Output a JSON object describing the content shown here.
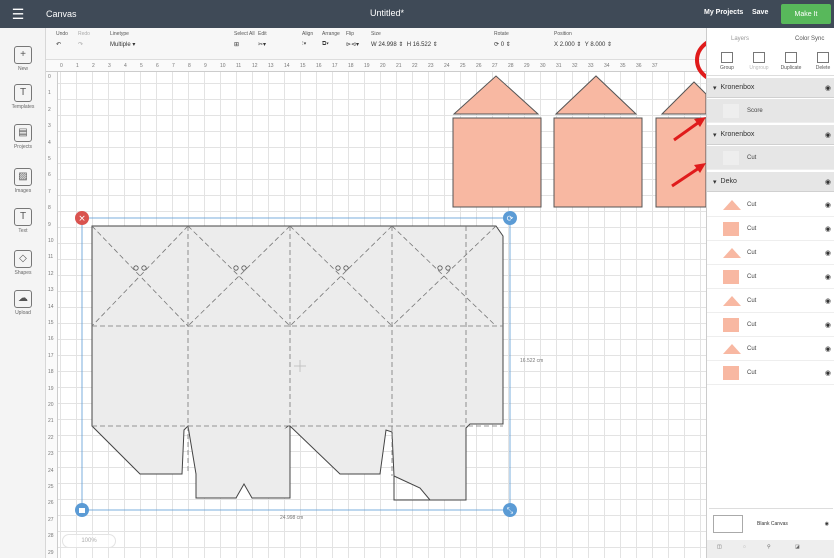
{
  "topbar": {
    "app_title": "Canvas",
    "doc_title": "Untitled*",
    "my_projects": "My Projects",
    "save": "Save",
    "make_it": "Make It"
  },
  "leftbar": [
    {
      "label": "New",
      "icon": "plus-icon",
      "glyph": "+"
    },
    {
      "label": "Templates",
      "icon": "shirt-icon",
      "glyph": "T"
    },
    {
      "label": "Projects",
      "icon": "projects-icon",
      "glyph": "▤"
    },
    {
      "label": "Images",
      "icon": "images-icon",
      "glyph": "▨"
    },
    {
      "label": "Text",
      "icon": "text-icon",
      "glyph": "T"
    },
    {
      "label": "Shapes",
      "icon": "shapes-icon",
      "glyph": "◇"
    },
    {
      "label": "Upload",
      "icon": "upload-icon",
      "glyph": "☁"
    }
  ],
  "editbar": {
    "undo": "Undo",
    "redo": "Redo",
    "linetype_label": "Linetype",
    "linetype_value": "Multiple",
    "select_all": "Select All",
    "edit": "Edit",
    "align": "Align",
    "arrange": "Arrange",
    "flip": "Flip",
    "size": "Size",
    "width_label": "W",
    "width_value": "24.998",
    "height_label": "H",
    "height_value": "16.522",
    "rotate": "Rotate",
    "rotate_value": "0",
    "position": "Position",
    "x_label": "X",
    "x_value": "2.000",
    "y_label": "Y",
    "y_value": "8.000"
  },
  "layers": {
    "tab_layers": "Layers",
    "tab_color_sync": "Color Sync",
    "tools": [
      "Group",
      "Ungroup",
      "Duplicate",
      "Delete"
    ],
    "groups": [
      {
        "name": "Kronenbox",
        "children": [
          "Score"
        ]
      },
      {
        "name": "Kronenbox",
        "children": [
          "Cut"
        ]
      },
      {
        "name": "Deko",
        "children": [
          "Cut",
          "Cut",
          "Cut",
          "Cut",
          "Cut",
          "Cut",
          "Cut",
          "Cut"
        ]
      }
    ],
    "deko_shapes": [
      "tri",
      "sq",
      "tri",
      "sq",
      "tri",
      "sq",
      "tri",
      "sq"
    ],
    "blank_canvas": "Blank Canvas"
  },
  "canvas": {
    "ruler_top": [
      "0",
      "1",
      "2",
      "3",
      "4",
      "5",
      "6",
      "7",
      "8",
      "9",
      "10",
      "11",
      "12",
      "13",
      "14",
      "15",
      "16",
      "17",
      "18",
      "19",
      "20",
      "21",
      "22",
      "23",
      "24",
      "25",
      "26",
      "27",
      "28",
      "29",
      "30",
      "31",
      "32",
      "33",
      "34",
      "35",
      "36",
      "37"
    ],
    "ruler_left": [
      "0",
      "1",
      "2",
      "3",
      "4",
      "5",
      "6",
      "7",
      "8",
      "9",
      "10",
      "11",
      "12",
      "13",
      "14",
      "15",
      "16",
      "17",
      "18",
      "19",
      "20",
      "21",
      "22",
      "23",
      "24",
      "25",
      "26",
      "27",
      "28",
      "29"
    ],
    "width_label": "24.998 cm",
    "height_label": "16.522 cm",
    "zoom": "100%"
  },
  "colors": {
    "topbar": "#3f4a57",
    "make_it": "#58b85b",
    "peach": "#f8b8a2",
    "selection": "#5b9bd5",
    "delete": "#d9534f",
    "annotation": "#e01b1b"
  }
}
